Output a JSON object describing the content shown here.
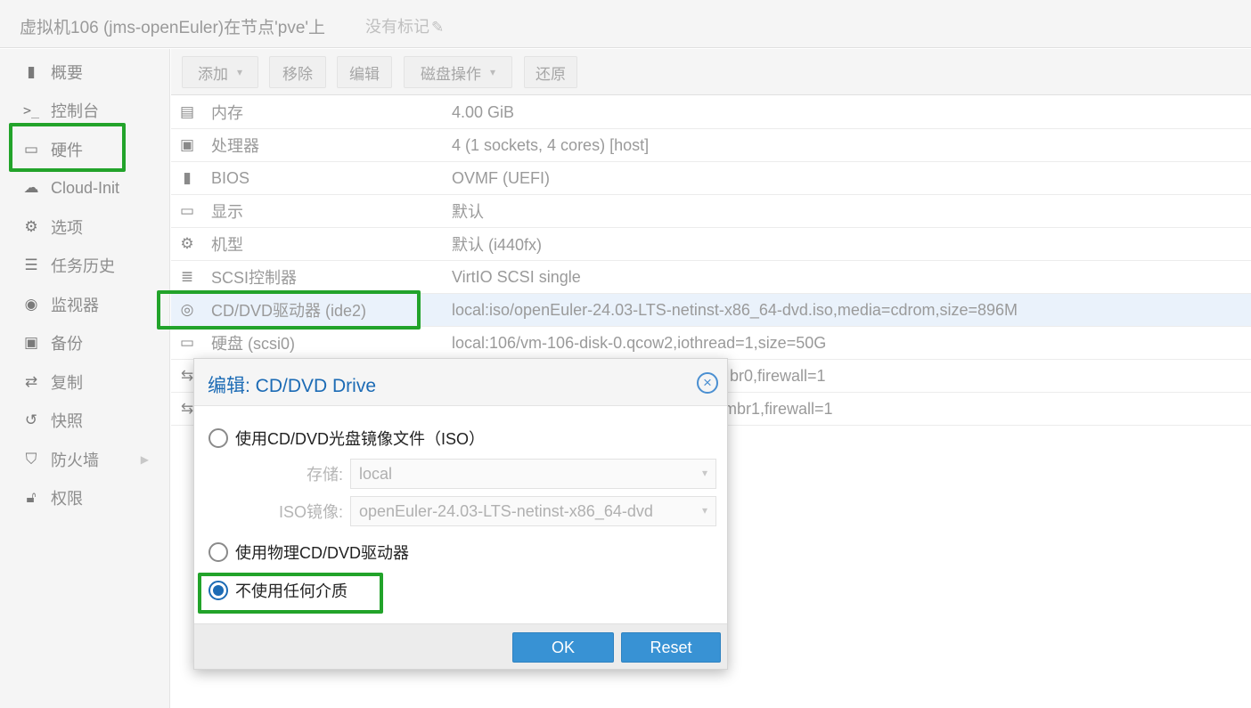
{
  "header": {
    "title": "虚拟机106 (jms-openEuler)在节点'pve'上",
    "tags_label": "没有标记"
  },
  "sidebar": {
    "items": [
      {
        "label": "概要",
        "icon": "book-icon"
      },
      {
        "label": "控制台",
        "icon": "terminal-icon"
      },
      {
        "label": "硬件",
        "icon": "desktop-icon"
      },
      {
        "label": "Cloud-Init",
        "icon": "cloud-icon"
      },
      {
        "label": "选项",
        "icon": "gear-icon"
      },
      {
        "label": "任务历史",
        "icon": "list-icon"
      },
      {
        "label": "监视器",
        "icon": "eye-icon"
      },
      {
        "label": "备份",
        "icon": "save-icon"
      },
      {
        "label": "复制",
        "icon": "retweet-icon"
      },
      {
        "label": "快照",
        "icon": "history-icon"
      },
      {
        "label": "防火墙",
        "icon": "shield-icon"
      },
      {
        "label": "权限",
        "icon": "unlock-icon"
      }
    ],
    "active": "硬件"
  },
  "toolbar": {
    "add_label": "添加",
    "remove_label": "移除",
    "edit_label": "编辑",
    "disk_action_label": "磁盘操作",
    "revert_label": "还原"
  },
  "hardware": {
    "rows": [
      {
        "key": "内存",
        "value": "4.00 GiB",
        "icon": "memory-icon"
      },
      {
        "key": "处理器",
        "value": "4 (1 sockets, 4 cores) [host]",
        "icon": "cpu-icon"
      },
      {
        "key": "BIOS",
        "value": "OVMF (UEFI)",
        "icon": "chip-icon"
      },
      {
        "key": "显示",
        "value": "默认",
        "icon": "desktop-icon"
      },
      {
        "key": "机型",
        "value": "默认 (i440fx)",
        "icon": "cogs-icon"
      },
      {
        "key": "SCSI控制器",
        "value": "VirtIO SCSI single",
        "icon": "database-icon"
      },
      {
        "key": "CD/DVD驱动器 (ide2)",
        "value": "local:iso/openEuler-24.03-LTS-netinst-x86_64-dvd.iso,media=cdrom,size=896M",
        "icon": "cdrom-icon"
      },
      {
        "key": "硬盘 (scsi0)",
        "value": "local:106/vm-106-disk-0.qcow2,iothread=1,size=50G",
        "icon": "hdd-icon"
      },
      {
        "key": "",
        "value": "br0,firewall=1",
        "icon": "exchange-icon"
      },
      {
        "key": "",
        "value": "mbr1,firewall=1",
        "icon": "exchange-icon"
      }
    ],
    "selected_index": 6
  },
  "dialog": {
    "title": "编辑: CD/DVD Drive",
    "option_iso_label": "使用CD/DVD光盘镜像文件（ISO）",
    "storage_label": "存储:",
    "storage_value": "local",
    "iso_label": "ISO镜像:",
    "iso_value": "openEuler-24.03-LTS-netinst-x86_64-dvd",
    "option_physical_label": "使用物理CD/DVD驱动器",
    "option_none_label": "不使用任何介质",
    "selected_option": "不使用任何介质",
    "ok_label": "OK",
    "reset_label": "Reset"
  },
  "colors": {
    "highlight_border": "#22a32a",
    "primary_button": "#3892d4",
    "dialog_title": "#1c6bb5",
    "selected_row": "#eaf2fb"
  }
}
